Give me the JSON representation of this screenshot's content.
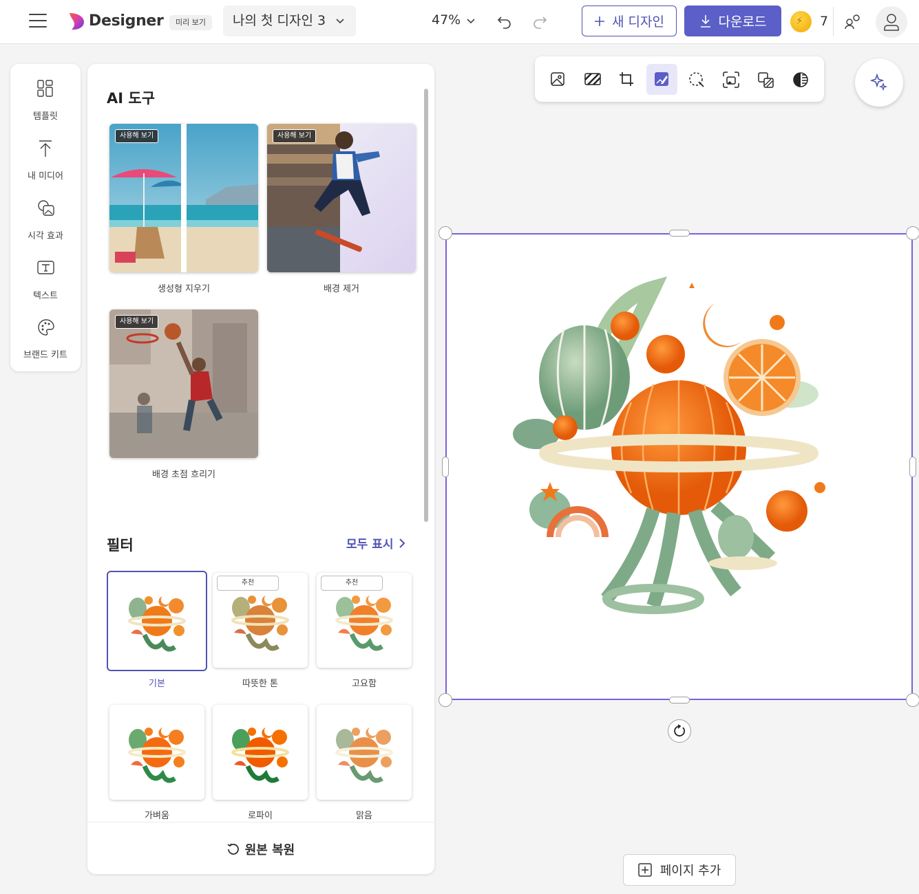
{
  "topbar": {
    "brand": "Designer",
    "preview_badge": "미리 보기",
    "doc_name": "나의 첫 디자인 3",
    "zoom": "47%",
    "new_design": "새 디자인",
    "download": "다운로드",
    "credits": "7"
  },
  "rail": {
    "items": [
      {
        "label": "템플릿",
        "icon": "templates-icon"
      },
      {
        "label": "내 미디어",
        "icon": "upload-icon"
      },
      {
        "label": "시각 효과",
        "icon": "visuals-icon"
      },
      {
        "label": "텍스트",
        "icon": "text-icon"
      },
      {
        "label": "브랜드 키트",
        "icon": "palette-icon"
      }
    ]
  },
  "panel": {
    "ai_title": "AI 도구",
    "try_badge": "사용해 보기",
    "tools": [
      {
        "label": "생성형 지우기"
      },
      {
        "label": "배경 제거"
      },
      {
        "label": "배경 초점 흐리기"
      }
    ],
    "filters_title": "필터",
    "show_all": "모두 표시",
    "recommended": "추천",
    "filters": [
      {
        "label": "기본",
        "selected": true
      },
      {
        "label": "따뜻한 톤",
        "recommended": true
      },
      {
        "label": "고요함",
        "recommended": true
      },
      {
        "label": "가벼움"
      },
      {
        "label": "로파이"
      },
      {
        "label": "맑음"
      }
    ],
    "restore": "원본 복원"
  },
  "image_toolbar": {
    "buttons": [
      "image-icon",
      "background-icon",
      "crop-icon",
      "edit-image-icon",
      "select-icon",
      "frame-icon",
      "layers-icon",
      "adjust-icon"
    ],
    "active": "edit-image-icon"
  },
  "canvas": {
    "add_page": "페이지 추가"
  },
  "colors": {
    "accent": "#5b5fc7",
    "accent_dark": "#4f52b2",
    "selection": "#7e5fd8",
    "orange": "#f07a1a",
    "sage": "#8fb99a"
  }
}
